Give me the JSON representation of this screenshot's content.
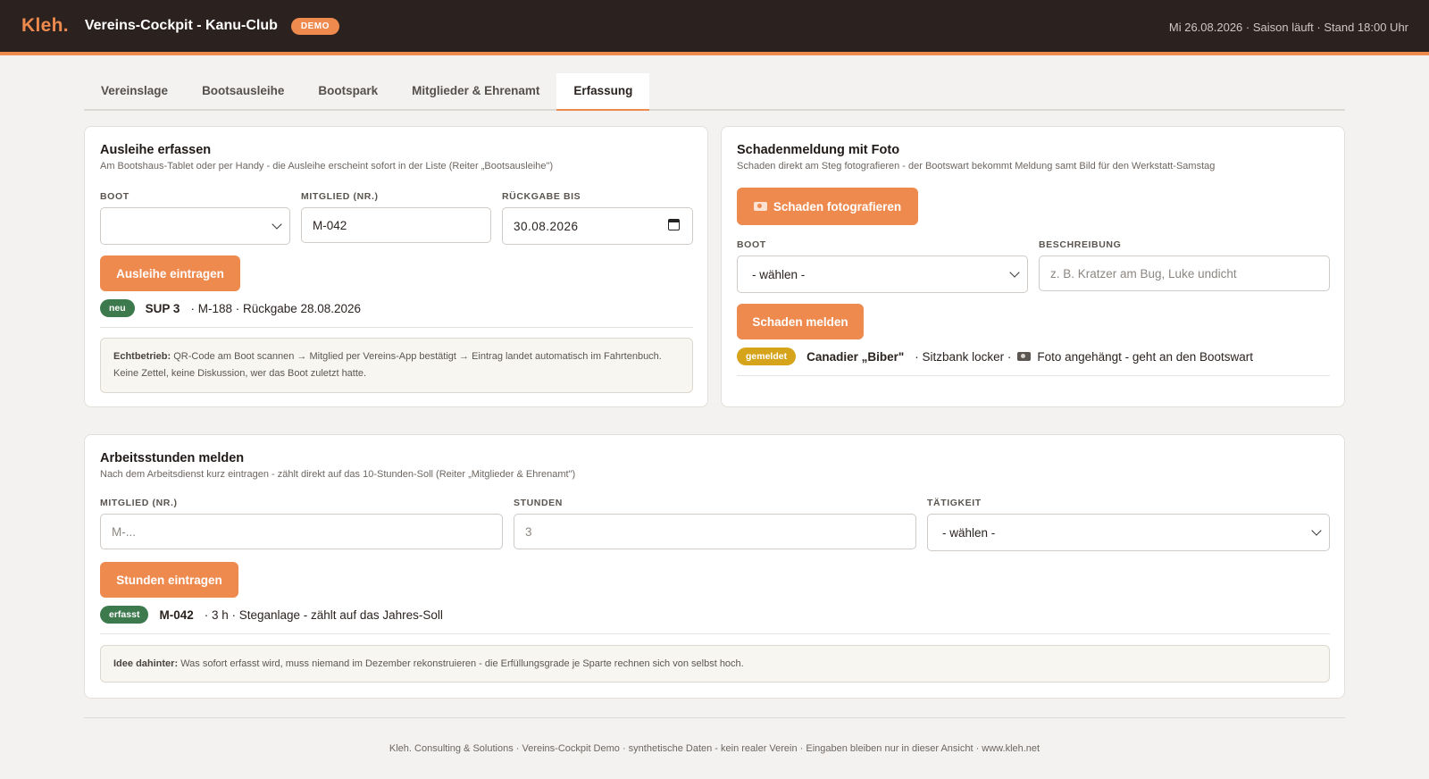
{
  "header": {
    "logo": "Kleh.",
    "title": "Vereins-Cockpit - Kanu-Club",
    "badge": "DEMO",
    "status": "Mi 26.08.2026 · Saison läuft · Stand 18:00 Uhr"
  },
  "tabs": [
    {
      "label": "Vereinslage",
      "active": false
    },
    {
      "label": "Bootsausleihe",
      "active": false
    },
    {
      "label": "Bootspark",
      "active": false
    },
    {
      "label": "Mitglieder & Ehrenamt",
      "active": false
    },
    {
      "label": "Erfassung",
      "active": true
    }
  ],
  "ausleihe": {
    "title": "Ausleihe erfassen",
    "subtitle": "Am Bootshaus-Tablet oder per Handy - die Ausleihe erscheint sofort in der Liste (Reiter „Bootsausleihe\")",
    "boot_label": "BOOT",
    "boot_value": "",
    "mitglied_label": "MITGLIED (NR.)",
    "mitglied_value": "M-042",
    "rueckgabe_label": "RÜCKGABE BIS",
    "rueckgabe_value": "30.08.2026",
    "button": "Ausleihe eintragen",
    "result_badge": "neu",
    "result_boat": "SUP 3",
    "result_text": "· M-188 · Rückgabe 28.08.2026",
    "note_bold": "Echtbetrieb:",
    "note_text": "QR-Code am Boot scannen → Mitglied per Vereins-App bestätigt → Eintrag landet automatisch im Fahrtenbuch. Keine Zettel, keine Diskussion, wer das Boot zuletzt hatte."
  },
  "schaden": {
    "title": "Schadenmeldung mit Foto",
    "subtitle": "Schaden direkt am Steg fotografieren - der Bootswart bekommt Meldung samt Bild für den Werkstatt-Samstag",
    "photo_button": "Schaden fotografieren",
    "boot_label": "BOOT",
    "boot_value": "- wählen -",
    "beschreibung_label": "BESCHREIBUNG",
    "beschreibung_placeholder": "z. B. Kratzer am Bug, Luke undicht",
    "button": "Schaden melden",
    "result_badge": "gemeldet",
    "result_boat": "Canadier „Biber\"",
    "result_text": "· Sitzbank locker ·",
    "result_text2": "Foto angehängt - geht an den Bootswart",
    "icon": "camera-icon"
  },
  "arbeit": {
    "title": "Arbeitsstunden melden",
    "subtitle": "Nach dem Arbeitsdienst kurz eintragen - zählt direkt auf das 10-Stunden-Soll (Reiter „Mitglieder & Ehrenamt\")",
    "mitglied_label": "MITGLIED (NR.)",
    "mitglied_placeholder": "M-...",
    "stunden_label": "STUNDEN",
    "stunden_placeholder": "3",
    "taetigkeit_label": "TÄTIGKEIT",
    "taetigkeit_value": "- wählen -",
    "button": "Stunden eintragen",
    "result_badge": "erfasst",
    "result_member": "M-042",
    "result_text": "· 3 h · Steganlage - zählt auf das Jahres-Soll",
    "note_bold": "Idee dahinter:",
    "note_text": "Was sofort erfasst wird, muss niemand im Dezember rekonstruieren - die Erfüllungsgrade je Sparte rechnen sich von selbst hoch."
  },
  "footer": "Kleh. Consulting & Solutions · Vereins-Cockpit Demo · synthetische Daten - kein realer Verein · Eingaben bleiben nur in dieser Ansicht · www.kleh.net",
  "colors": {
    "accent": "#ef8a4e",
    "header_bg": "#2b2220",
    "badge_green": "#3c7a4e",
    "badge_yellow": "#d6a41b"
  }
}
